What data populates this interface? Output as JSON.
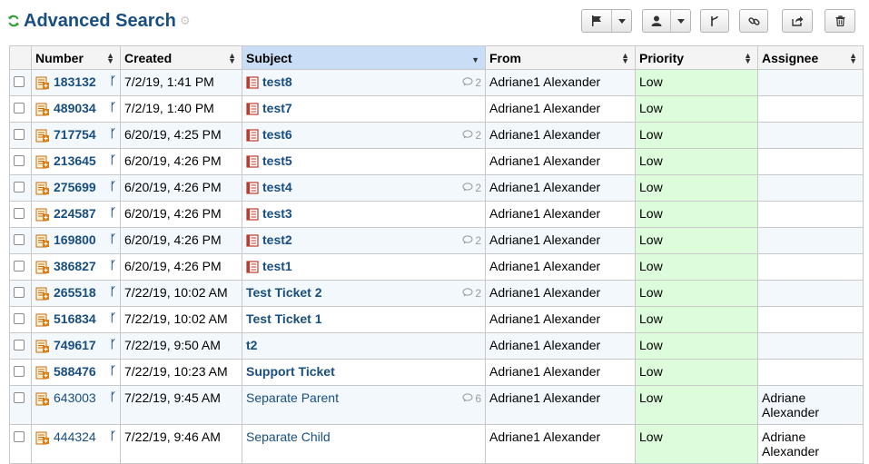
{
  "header": {
    "title": "Advanced Search"
  },
  "toolbar": {
    "buttons": [
      {
        "name": "flag-dropdown-button",
        "icon": "flag-icon",
        "has_caret": true
      },
      {
        "name": "user-dropdown-button",
        "icon": "user-icon",
        "has_caret": true
      },
      {
        "name": "merge-button",
        "icon": "merge-icon",
        "has_caret": false
      },
      {
        "name": "link-button",
        "icon": "link-icon",
        "has_caret": false
      },
      {
        "name": "share-button",
        "icon": "share-icon",
        "has_caret": false
      },
      {
        "name": "delete-button",
        "icon": "trash-icon",
        "has_caret": false
      }
    ]
  },
  "table": {
    "columns": [
      "Number",
      "Created",
      "Subject",
      "From",
      "Priority",
      "Assignee"
    ],
    "sorted_column": "Subject",
    "rows": [
      {
        "number": "183132",
        "created": "7/2/19, 1:41 PM",
        "subject": "test8",
        "thread_icon": true,
        "count": "2",
        "from": "Adriane1 Alexander",
        "priority": "Low",
        "assignee": "",
        "bold": true
      },
      {
        "number": "489034",
        "created": "7/2/19, 1:40 PM",
        "subject": "test7",
        "thread_icon": true,
        "count": "",
        "from": "Adriane1 Alexander",
        "priority": "Low",
        "assignee": "",
        "bold": true
      },
      {
        "number": "717754",
        "created": "6/20/19, 4:25 PM",
        "subject": "test6",
        "thread_icon": true,
        "count": "2",
        "from": "Adriane1 Alexander",
        "priority": "Low",
        "assignee": "",
        "bold": true
      },
      {
        "number": "213645",
        "created": "6/20/19, 4:26 PM",
        "subject": "test5",
        "thread_icon": true,
        "count": "",
        "from": "Adriane1 Alexander",
        "priority": "Low",
        "assignee": "",
        "bold": true
      },
      {
        "number": "275699",
        "created": "6/20/19, 4:26 PM",
        "subject": "test4",
        "thread_icon": true,
        "count": "2",
        "from": "Adriane1 Alexander",
        "priority": "Low",
        "assignee": "",
        "bold": true
      },
      {
        "number": "224587",
        "created": "6/20/19, 4:26 PM",
        "subject": "test3",
        "thread_icon": true,
        "count": "",
        "from": "Adriane1 Alexander",
        "priority": "Low",
        "assignee": "",
        "bold": true
      },
      {
        "number": "169800",
        "created": "6/20/19, 4:26 PM",
        "subject": "test2",
        "thread_icon": true,
        "count": "2",
        "from": "Adriane1 Alexander",
        "priority": "Low",
        "assignee": "",
        "bold": true
      },
      {
        "number": "386827",
        "created": "6/20/19, 4:26 PM",
        "subject": "test1",
        "thread_icon": true,
        "count": "",
        "from": "Adriane1 Alexander",
        "priority": "Low",
        "assignee": "",
        "bold": true
      },
      {
        "number": "265518",
        "created": "7/22/19, 10:02 AM",
        "subject": "Test Ticket 2",
        "thread_icon": false,
        "count": "2",
        "from": "Adriane1 Alexander",
        "priority": "Low",
        "assignee": "",
        "bold": true
      },
      {
        "number": "516834",
        "created": "7/22/19, 10:02 AM",
        "subject": "Test Ticket 1",
        "thread_icon": false,
        "count": "",
        "from": "Adriane1 Alexander",
        "priority": "Low",
        "assignee": "",
        "bold": true
      },
      {
        "number": "749617",
        "created": "7/22/19, 9:50 AM",
        "subject": "t2",
        "thread_icon": false,
        "count": "",
        "from": "Adriane1 Alexander",
        "priority": "Low",
        "assignee": "",
        "bold": true
      },
      {
        "number": "588476",
        "created": "7/22/19, 10:23 AM",
        "subject": "Support Ticket",
        "thread_icon": false,
        "count": "",
        "from": "Adriane1 Alexander",
        "priority": "Low",
        "assignee": "",
        "bold": true
      },
      {
        "number": "643003",
        "created": "7/22/19, 9:45 AM",
        "subject": "Separate Parent",
        "thread_icon": false,
        "count": "6",
        "from": "Adriane1 Alexander",
        "priority": "Low",
        "assignee": "Adriane Alexander",
        "bold": false
      },
      {
        "number": "444324",
        "created": "7/22/19, 9:46 AM",
        "subject": "Separate Child",
        "thread_icon": false,
        "count": "",
        "from": "Adriane1 Alexander",
        "priority": "Low",
        "assignee": "Adriane Alexander",
        "bold": false
      }
    ]
  },
  "colors": {
    "link": "#184e81",
    "priority_bg": "#dcfcdc",
    "row_alt": "#f3f8fd",
    "sorted_header": "#c9ddf6",
    "refresh": "#2e9e2e"
  }
}
